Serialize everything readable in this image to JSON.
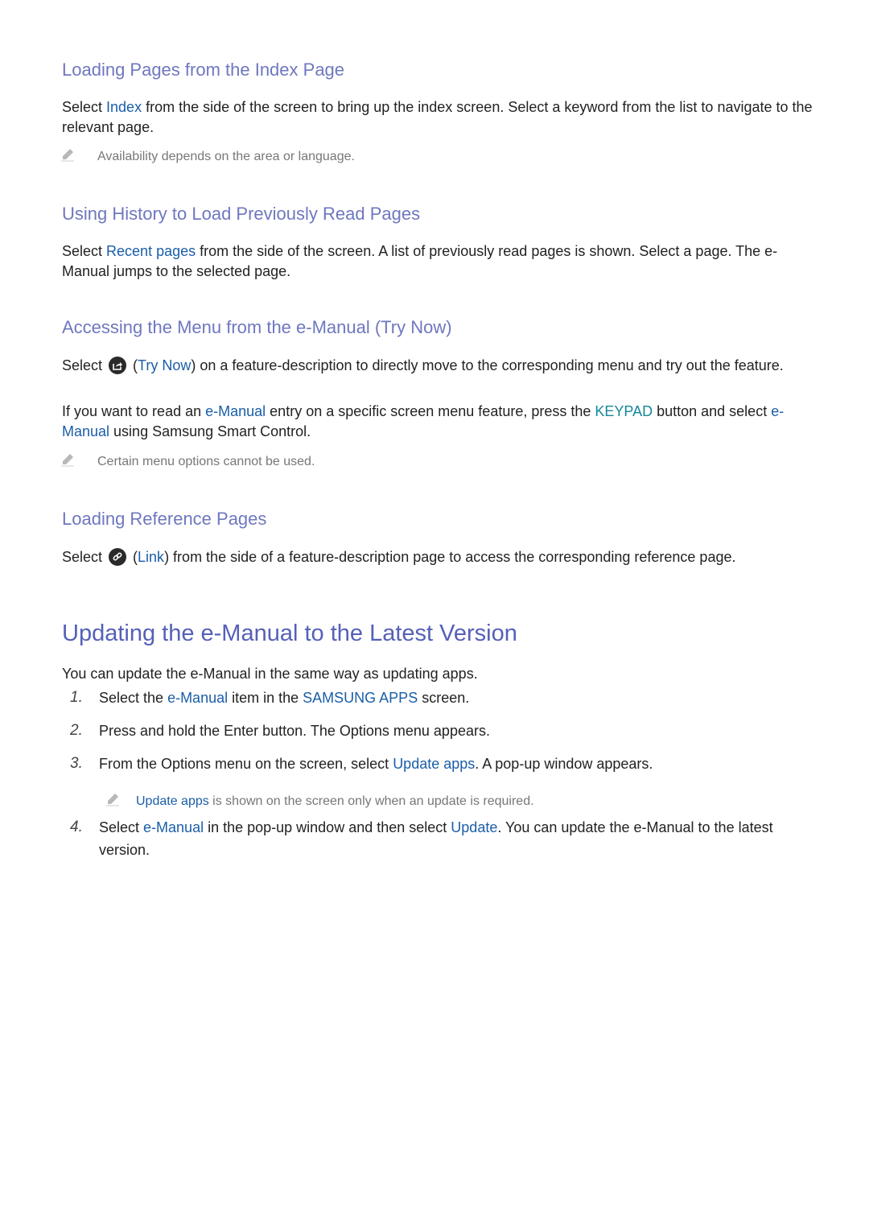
{
  "sections": {
    "index": {
      "heading": "Loading Pages from the Index Page",
      "p_pre": "Select ",
      "p_hl": "Index",
      "p_post": " from the side of the screen to bring up the index screen. Select a keyword from the list to navigate to the relevant page.",
      "note": "Availability depends on the area or language."
    },
    "history": {
      "heading": "Using History to Load Previously Read Pages",
      "p_pre": "Select ",
      "p_hl": "Recent pages",
      "p_post": " from the side of the screen. A list of previously read pages is shown. Select a page. The e-Manual jumps to the selected page."
    },
    "trynow": {
      "heading": "Accessing the Menu from the e-Manual (Try Now)",
      "p1_pre": "Select ",
      "p1_open": " (",
      "p1_hl": "Try Now",
      "p1_post": ") on a feature-description to directly move to the corresponding menu and try out the feature.",
      "p2_a": "If you want to read an ",
      "p2_hl1": "e-Manual",
      "p2_b": " entry on a specific screen menu feature, press the ",
      "p2_hl2": "KEYPAD",
      "p2_c": " button and select ",
      "p2_hl3": "e-Manual",
      "p2_d": " using Samsung Smart Control.",
      "note": "Certain menu options cannot be used.",
      "icon": "try-now-icon"
    },
    "reference": {
      "heading": "Loading Reference Pages",
      "p_pre": "Select ",
      "p_open": " (",
      "p_hl": "Link",
      "p_post": ") from the side of a feature-description page to access the corresponding reference page.",
      "icon": "link-icon"
    },
    "update": {
      "heading": "Updating the e-Manual to the Latest Version",
      "intro": "You can update the e-Manual in the same way as updating apps.",
      "steps": [
        {
          "num": "1.",
          "a": "Select the ",
          "hl1": "e-Manual",
          "b": " item in the ",
          "hl2": "SAMSUNG APPS",
          "c": " screen."
        },
        {
          "num": "2.",
          "a": "Press and hold the Enter button. The Options menu appears."
        },
        {
          "num": "3.",
          "a": "From the Options menu on the screen, select ",
          "hl1": "Update apps",
          "b": ". A pop-up window appears."
        },
        {
          "num": "4.",
          "a": "Select ",
          "hl1": "e-Manual",
          "b": " in the pop-up window and then select ",
          "hl2": "Update",
          "c": ". You can update the e-Manual to the latest version."
        }
      ],
      "note_hl": "Update apps",
      "note_post": " is shown on the screen only when an update is required."
    }
  },
  "colors": {
    "heading": "#6f77bf",
    "title": "#5560b8",
    "highlight": "#1a5ea8",
    "highlight_teal": "#15879a",
    "note": "#777777"
  }
}
